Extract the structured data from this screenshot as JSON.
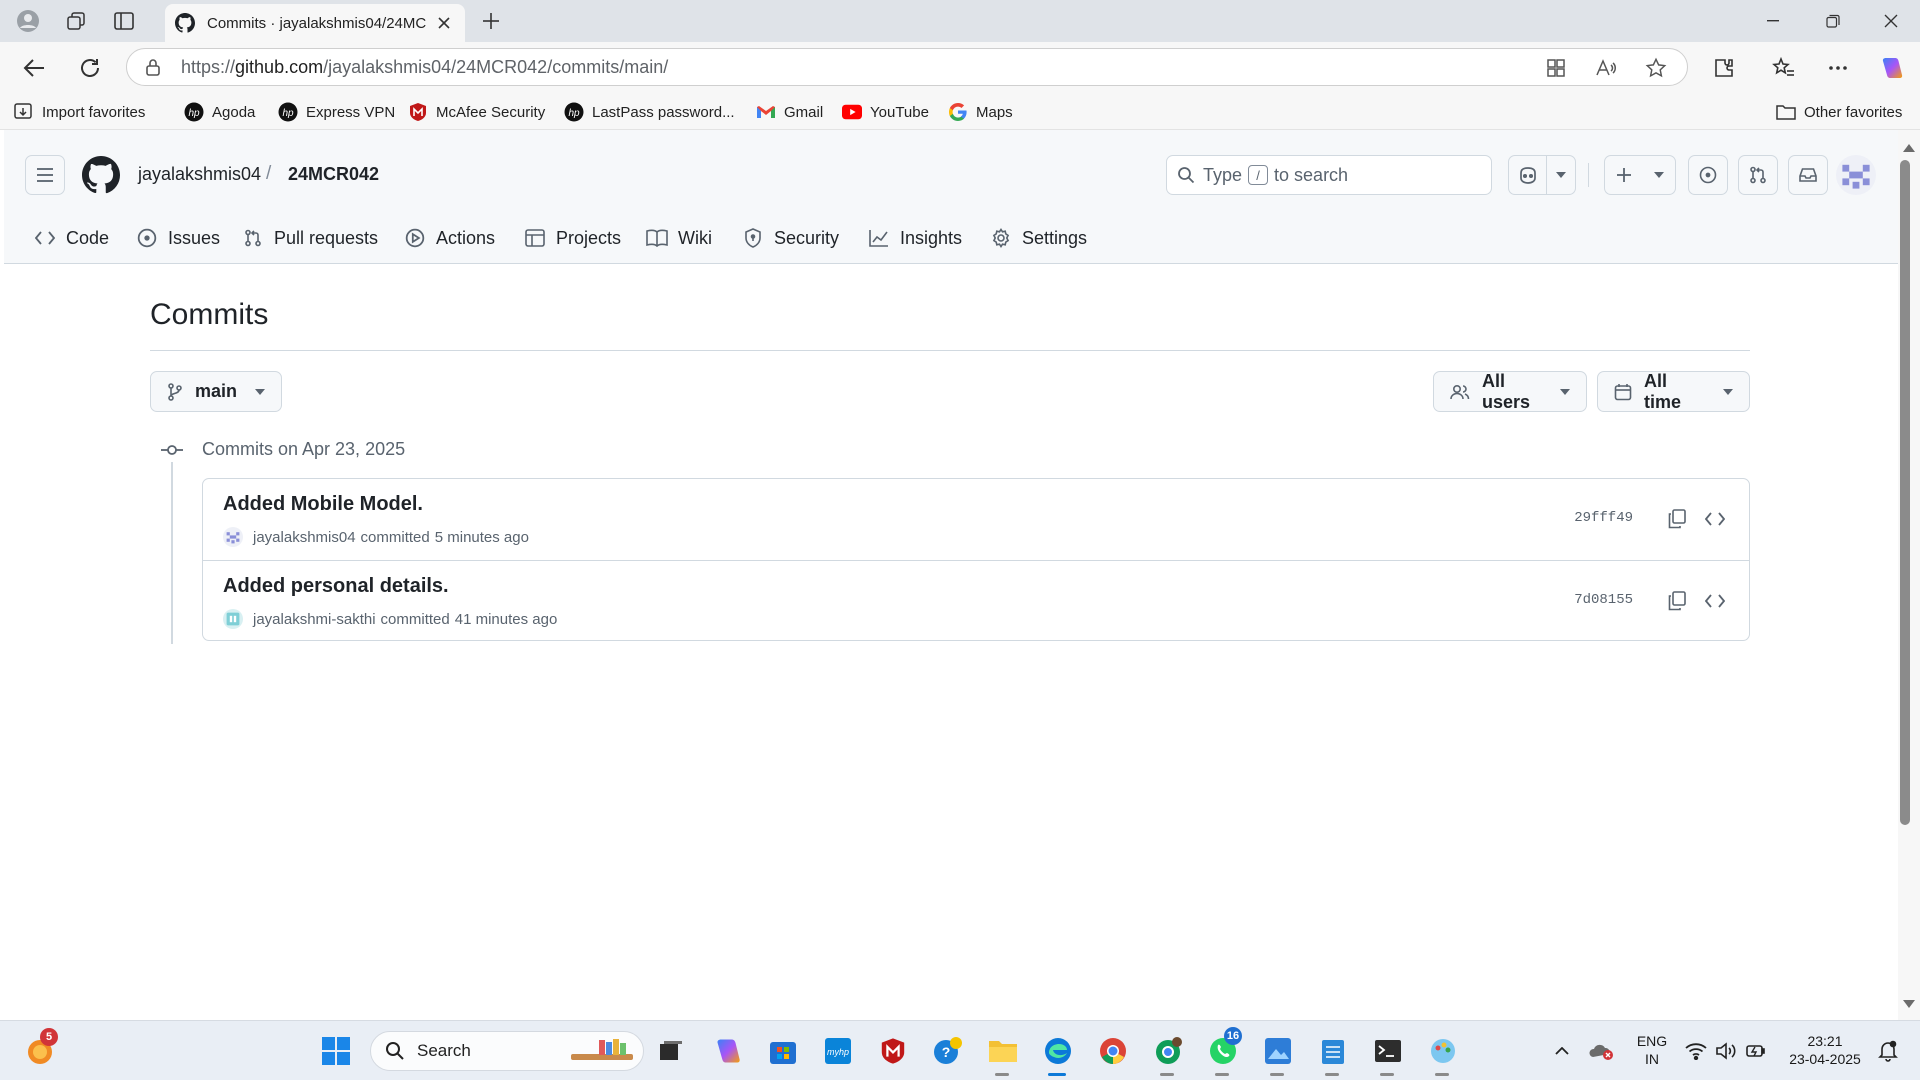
{
  "browser": {
    "tab_title": "Commits · jayalakshmis04/24MCR042",
    "url_prefix": "https://",
    "url_host": "github.com",
    "url_path": "/jayalakshmis04/24MCR042/commits/main/",
    "favorites": [
      {
        "label": "Import favorites",
        "icon": "import-icon"
      },
      {
        "label": "Agoda",
        "icon": "hp-icon"
      },
      {
        "label": "Express VPN",
        "icon": "hp-icon"
      },
      {
        "label": "McAfee Security",
        "icon": "mcafee-icon"
      },
      {
        "label": "LastPass password...",
        "icon": "hp-icon"
      },
      {
        "label": "Gmail",
        "icon": "gmail-icon"
      },
      {
        "label": "YouTube",
        "icon": "youtube-icon"
      },
      {
        "label": "Maps",
        "icon": "google-icon"
      }
    ],
    "other_favorites": "Other favorites"
  },
  "github": {
    "owner": "jayalakshmis04",
    "separator": "/",
    "repo": "24MCR042",
    "search_prefix": "Type",
    "search_key": "/",
    "search_suffix": "to search",
    "nav": [
      {
        "label": "Code",
        "icon": "code-icon"
      },
      {
        "label": "Issues",
        "icon": "issue-icon"
      },
      {
        "label": "Pull requests",
        "icon": "pull-request-icon"
      },
      {
        "label": "Actions",
        "icon": "play-icon"
      },
      {
        "label": "Projects",
        "icon": "table-icon"
      },
      {
        "label": "Wiki",
        "icon": "book-icon"
      },
      {
        "label": "Security",
        "icon": "shield-icon"
      },
      {
        "label": "Insights",
        "icon": "graph-icon"
      },
      {
        "label": "Settings",
        "icon": "gear-icon"
      }
    ]
  },
  "commits_page": {
    "title": "Commits",
    "branch": "main",
    "users_filter": "All users",
    "time_filter": "All time",
    "date_heading": "Commits on Apr 23, 2025",
    "commits": [
      {
        "title": "Added Mobile Model.",
        "author": "jayalakshmis04",
        "action": "committed",
        "time": "5 minutes ago",
        "sha": "29fff49"
      },
      {
        "title": "Added personal details.",
        "author": "jayalakshmi-sakthi",
        "action": "committed",
        "time": "41 minutes ago",
        "sha": "7d08155"
      }
    ]
  },
  "taskbar": {
    "search_placeholder": "Search",
    "notification_badge": "5",
    "whatsapp_badge": "16",
    "language": "ENG",
    "region": "IN",
    "time": "23:21",
    "date": "23-04-2025"
  },
  "colors": {
    "accent": "#0969da",
    "border": "#d1d9e0",
    "header_bg": "#f6f8fa",
    "muted_text": "#59636e"
  }
}
